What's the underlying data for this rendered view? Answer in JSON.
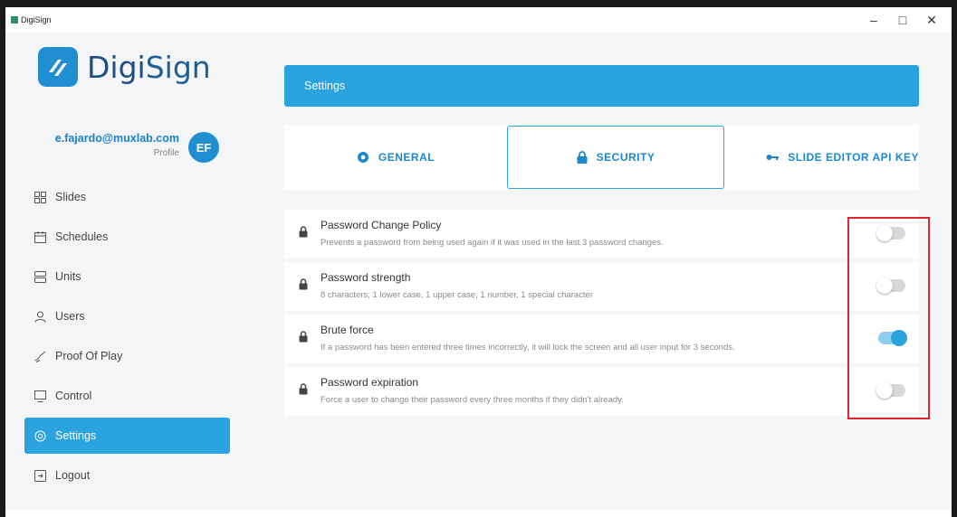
{
  "window": {
    "title": "DigiSign",
    "minimize_glyph": "–",
    "maximize_glyph": "□",
    "close_glyph": "✕"
  },
  "logo": {
    "prefix": "Digi",
    "suffix": "Sign",
    "mark_icon": "digisign-logo-icon"
  },
  "user": {
    "email": "e.fajardo@muxlab.com",
    "profile_label": "Profile",
    "initials": "EF"
  },
  "sidebar": {
    "items": [
      {
        "label": "Slides",
        "icon": "grid-icon"
      },
      {
        "label": "Schedules",
        "icon": "calendar-icon"
      },
      {
        "label": "Units",
        "icon": "server-icon"
      },
      {
        "label": "Users",
        "icon": "user-icon"
      },
      {
        "label": "Proof Of Play",
        "icon": "signature-icon"
      },
      {
        "label": "Control",
        "icon": "monitor-icon"
      },
      {
        "label": "Settings",
        "icon": "gear-icon",
        "active": true
      },
      {
        "label": "Logout",
        "icon": "logout-icon"
      }
    ]
  },
  "settings": {
    "header": "Settings",
    "tabs": [
      {
        "label": "GENERAL",
        "icon": "cog-icon"
      },
      {
        "label": "SECURITY",
        "icon": "lock-icon",
        "active": true
      },
      {
        "label": "SLIDE EDITOR API KEY",
        "icon": "key-icon"
      }
    ],
    "policies": [
      {
        "title": "Password Change Policy",
        "description": "Prevents a password from being used again if it was used in the last 3 password changes.",
        "enabled": false
      },
      {
        "title": "Password strength",
        "description": "8 characters, 1 lower case, 1 upper case, 1 number, 1 special character",
        "enabled": false
      },
      {
        "title": "Brute force",
        "description": "If a password has been entered three times incorrectly, it will lock the screen and all user input for 3 seconds.",
        "enabled": true
      },
      {
        "title": "Password expiration",
        "description": "Force a user to change their password every three months if they didn't already.",
        "enabled": false
      }
    ]
  },
  "colors": {
    "accent": "#2aa3df",
    "highlight": "#e0262b"
  }
}
